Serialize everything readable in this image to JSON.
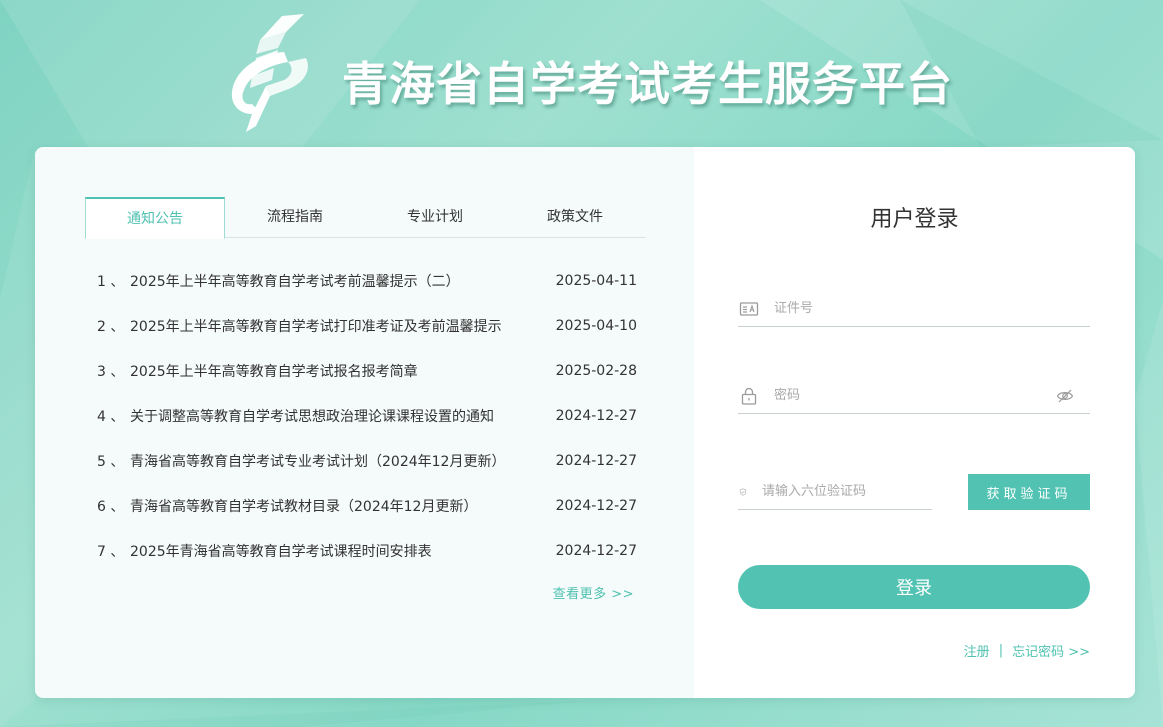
{
  "header": {
    "title": "青海省自学考试考生服务平台",
    "logo_icon": "exam-logo-icon"
  },
  "colors": {
    "accent": "#52c3b2",
    "background": "#8fdac9",
    "text": "#333333"
  },
  "tabs": [
    {
      "label": "通知公告",
      "active": true
    },
    {
      "label": "流程指南",
      "active": false
    },
    {
      "label": "专业计划",
      "active": false
    },
    {
      "label": "政策文件",
      "active": false
    }
  ],
  "notices": [
    {
      "num": "1 、",
      "title": "2025年上半年高等教育自学考试考前温馨提示（二）",
      "date": "2025-04-11"
    },
    {
      "num": "2 、",
      "title": "2025年上半年高等教育自学考试打印准考证及考前温馨提示",
      "date": "2025-04-10"
    },
    {
      "num": "3 、",
      "title": "2025年上半年高等教育自学考试报名报考简章",
      "date": "2025-02-28"
    },
    {
      "num": "4 、",
      "title": "关于调整高等教育自学考试思想政治理论课课程设置的通知",
      "date": "2024-12-27"
    },
    {
      "num": "5 、",
      "title": "青海省高等教育自学考试专业考试计划（2024年12月更新）",
      "date": "2024-12-27"
    },
    {
      "num": "6 、",
      "title": "青海省高等教育自学考试教材目录（2024年12月更新）",
      "date": "2024-12-27"
    },
    {
      "num": "7 、",
      "title": "2025年青海省高等教育自学考试课程时间安排表",
      "date": "2024-12-27"
    }
  ],
  "more_link": "查看更多 >>",
  "login": {
    "title": "用户登录",
    "id_placeholder": "证件号",
    "id_value": "",
    "password_placeholder": "密码",
    "password_value": "",
    "code_placeholder": "请输入六位验证码",
    "code_value": "",
    "get_code_label": "获取验证码",
    "login_label": "登录",
    "register_label": "注册",
    "separator": "|",
    "forgot_label": "忘记密码 >>"
  },
  "icons": {
    "id_field": "id-card-icon",
    "password_field": "lock-icon",
    "password_toggle": "eye-off-icon",
    "code_field": "shield-check-icon"
  }
}
